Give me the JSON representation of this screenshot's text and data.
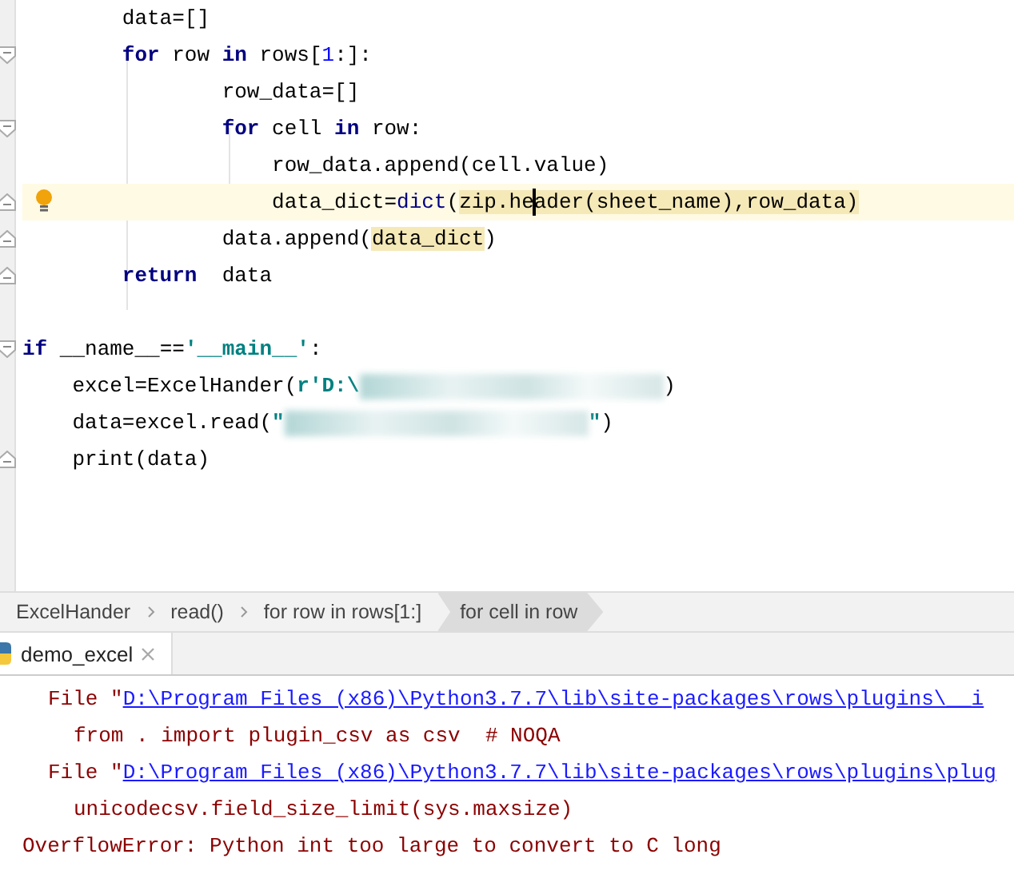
{
  "editor": {
    "method_lines": [
      {
        "fold_open": false,
        "fold_close": false,
        "current": false,
        "tokens": [
          {
            "kind": "text",
            "text": "data=[]"
          }
        ]
      },
      {
        "fold_open": true,
        "fold_close": false,
        "current": false,
        "tokens": [
          {
            "kind": "keyword",
            "text": "for"
          },
          {
            "kind": "text",
            "text": " row "
          },
          {
            "kind": "keyword",
            "text": "in"
          },
          {
            "kind": "text",
            "text": " rows["
          },
          {
            "kind": "number",
            "text": "1"
          },
          {
            "kind": "text",
            "text": ":]:"
          }
        ],
        "children": [
          {
            "fold_open": false,
            "fold_close": false,
            "current": false,
            "tokens": [
              {
                "kind": "text",
                "text": "row_data=[]"
              }
            ]
          },
          {
            "fold_open": true,
            "fold_close": false,
            "current": false,
            "tokens": [
              {
                "kind": "keyword",
                "text": "for"
              },
              {
                "kind": "text",
                "text": " cell "
              },
              {
                "kind": "keyword",
                "text": "in"
              },
              {
                "kind": "text",
                "text": " row:"
              }
            ],
            "children": [
              {
                "fold_open": false,
                "fold_close": false,
                "current": false,
                "tokens": [
                  {
                    "kind": "text",
                    "text": "row_data.append(cell.value)"
                  }
                ]
              },
              {
                "fold_open": false,
                "fold_close": true,
                "current": true,
                "tokens": [
                  {
                    "kind": "text",
                    "text": "data_dict="
                  },
                  {
                    "kind": "builtin",
                    "text": "dict"
                  },
                  {
                    "kind": "text",
                    "text": "("
                  },
                  {
                    "kind": "usage",
                    "text": "zip.he",
                    "caret": true
                  },
                  {
                    "kind": "usage",
                    "text": "ader(sheet_name),row_data)"
                  }
                ]
              }
            ]
          },
          {
            "fold_open": false,
            "fold_close": true,
            "current": false,
            "tokens": [
              {
                "kind": "text",
                "text": "data.append("
              },
              {
                "kind": "usage",
                "text": "data_dict"
              },
              {
                "kind": "text",
                "text": ")"
              }
            ]
          }
        ]
      },
      {
        "fold_open": false,
        "fold_close": true,
        "current": false,
        "tokens": [
          {
            "kind": "keyword",
            "text": "return"
          },
          {
            "kind": "text",
            "text": "  data"
          }
        ]
      }
    ],
    "module_lines": [
      {
        "fold_open": true,
        "fold_close": false,
        "current": false,
        "tokens": [
          {
            "kind": "keyword",
            "text": "if"
          },
          {
            "kind": "text",
            "text": " __name__=="
          },
          {
            "kind": "string",
            "text": "'__main__'"
          },
          {
            "kind": "text",
            "text": ":"
          }
        ],
        "children": [
          {
            "fold_open": false,
            "fold_close": false,
            "current": false,
            "tokens": [
              {
                "kind": "text",
                "text": "excel=ExcelHander("
              },
              {
                "kind": "string",
                "text": "r'D:\\"
              },
              {
                "kind": "redacted"
              },
              {
                "kind": "text",
                "text": ")"
              }
            ]
          },
          {
            "fold_open": false,
            "fold_close": false,
            "current": false,
            "tokens": [
              {
                "kind": "text",
                "text": "data=excel.read("
              },
              {
                "kind": "string",
                "text": "\""
              },
              {
                "kind": "redacted"
              },
              {
                "kind": "string",
                "text": "\""
              },
              {
                "kind": "text",
                "text": ")"
              }
            ]
          },
          {
            "fold_open": false,
            "fold_close": true,
            "current": false,
            "tokens": [
              {
                "kind": "text",
                "text": "print(data)"
              }
            ]
          }
        ]
      }
    ]
  },
  "breadcrumbs": [
    {
      "label": "ExcelHander",
      "selected": false
    },
    {
      "label": "read()",
      "selected": false
    },
    {
      "label": "for row in rows[1:]",
      "selected": false
    },
    {
      "label": "for cell in row",
      "selected": true
    }
  ],
  "run_tab": {
    "label": "demo_excel"
  },
  "console": [
    {
      "kind": "frame",
      "prefix": "File \"",
      "link": "D:\\Program Files (x86)\\Python3.7.7\\lib\\site-packages\\rows\\plugins\\__i"
    },
    {
      "kind": "code",
      "text": "from . import plugin_csv as csv  # NOQA"
    },
    {
      "kind": "frame",
      "prefix": "File \"",
      "link": "D:\\Program Files (x86)\\Python3.7.7\\lib\\site-packages\\rows\\plugins\\plug"
    },
    {
      "kind": "code",
      "text": "unicodecsv.field_size_limit(sys.maxsize)"
    },
    {
      "kind": "error",
      "text": "OverflowError: Python int too large to convert to C long"
    }
  ]
}
